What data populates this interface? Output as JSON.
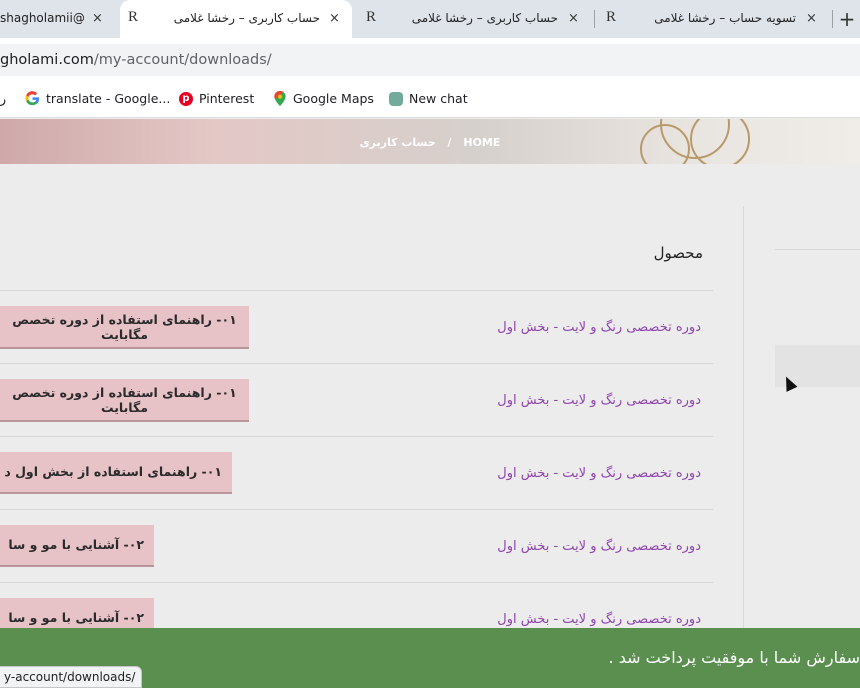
{
  "browser": {
    "tabs": [
      {
        "title": "shagholamii@",
        "close": "×"
      },
      {
        "title": "حساب کاربری – رخشا غلامی",
        "close": "×",
        "favicon": "R",
        "active": true
      },
      {
        "title": "حساب کاربری – رخشا غلامی",
        "close": "×",
        "favicon": "R"
      },
      {
        "title": "تسویه حساب – رخشا غلامی",
        "close": "×",
        "favicon": "R"
      }
    ],
    "new_tab": "+",
    "url_host": "gholami.com",
    "url_path": "/my-account/downloads/",
    "bookmarks": [
      {
        "label": "ر",
        "icon": "bookmark-icon"
      },
      {
        "label": "translate - Google...",
        "icon": "google-icon"
      },
      {
        "label": "Pinterest",
        "icon": "pinterest-icon"
      },
      {
        "label": "Google Maps",
        "icon": "google-maps-icon"
      },
      {
        "label": "New chat",
        "icon": "chatgpt-icon"
      }
    ]
  },
  "hero": {
    "breadcrumb_home": "HOME",
    "breadcrumb_sep": "/",
    "breadcrumb_current": "حساب کاربری"
  },
  "downloads": {
    "header_product": "محصول",
    "rows": [
      {
        "product": "دوره تخصصی رنگ و لایت - بخش اول",
        "file": "۰۱- راهنمای استفاده از دوره تخصص",
        "file2": "مگابایت"
      },
      {
        "product": "دوره تخصصی رنگ و لایت - بخش اول",
        "file": "۰۱- راهنمای استفاده از دوره تخصص",
        "file2": "مگابایت"
      },
      {
        "product": "دوره تخصصی رنگ و لایت - بخش اول",
        "file": "۰۱- راهنمای استفاده از بخش اول د"
      },
      {
        "product": "دوره تخصصی رنگ و لایت - بخش اول",
        "file": "۰۲- آشنایی با مو و سا"
      },
      {
        "product": "دوره تخصصی رنگ و لایت - بخش اول",
        "file": "۰۲- آشنایی با مو و سا"
      }
    ]
  },
  "notice": {
    "text": "سفارش شما با موفقیت پرداخت شد ."
  },
  "status_url": "y-account/downloads/",
  "colors": {
    "accent_link": "#8e44ad",
    "button_bg": "#e7c3c8",
    "notice_bg": "#5a8f4f"
  }
}
